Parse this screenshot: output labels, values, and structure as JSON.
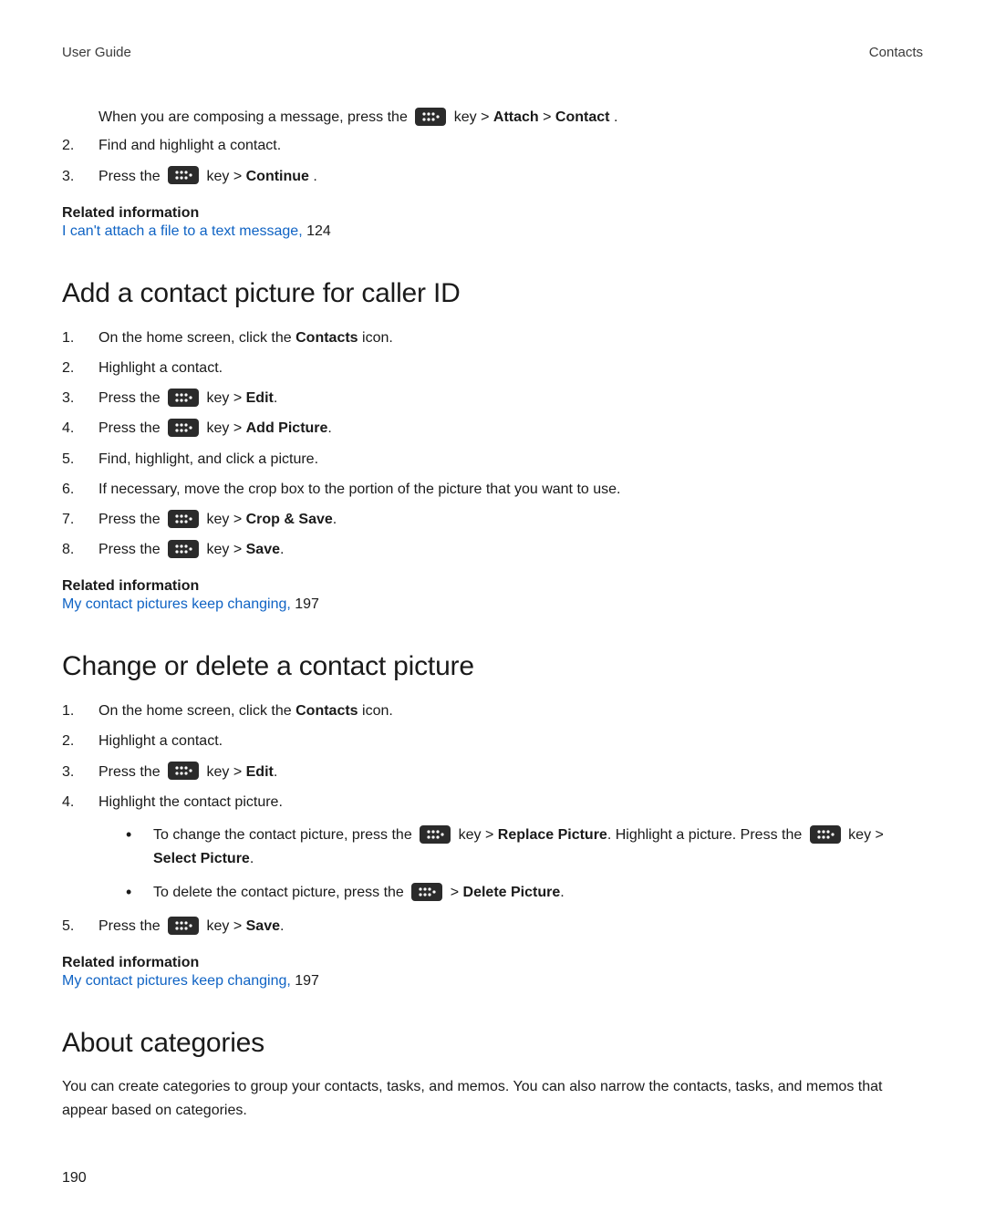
{
  "header": {
    "left": "User Guide",
    "right": "Contacts"
  },
  "page_number": "190",
  "intro_steps": {
    "s1": {
      "indent_text_a": "When you are composing a message, press the ",
      "indent_text_b": " key > ",
      "attach": "Attach",
      "sep": " > ",
      "contact": "Contact",
      "period": "."
    },
    "s2": {
      "num": "2.",
      "text": "Find and highlight a contact."
    },
    "s3": {
      "num": "3.",
      "text_a": "Press the ",
      "text_b": " key > ",
      "bold": "Continue",
      "period": "."
    }
  },
  "related1": {
    "heading": "Related information",
    "link": "I can't attach a file to a text message, ",
    "page": "124"
  },
  "sec_add": {
    "title": "Add a contact picture for caller ID",
    "steps": {
      "s1": {
        "num": "1.",
        "a": "On the home screen, click the ",
        "bold": "Contacts",
        "b": " icon."
      },
      "s2": {
        "num": "2.",
        "a": "Highlight a contact."
      },
      "s3": {
        "num": "3.",
        "a": "Press the ",
        "b": " key > ",
        "bold": "Edit",
        "c": "."
      },
      "s4": {
        "num": "4.",
        "a": "Press the ",
        "b": " key > ",
        "bold": "Add Picture",
        "c": "."
      },
      "s5": {
        "num": "5.",
        "a": "Find, highlight, and click a picture."
      },
      "s6": {
        "num": "6.",
        "a": "If necessary, move the crop box to the portion of the picture that you want to use."
      },
      "s7": {
        "num": "7.",
        "a": "Press the ",
        "b": " key > ",
        "bold": "Crop & Save",
        "c": "."
      },
      "s8": {
        "num": "8.",
        "a": "Press the ",
        "b": " key > ",
        "bold": "Save",
        "c": "."
      }
    },
    "related": {
      "heading": "Related information",
      "link": "My contact pictures keep changing, ",
      "page": "197"
    }
  },
  "sec_change": {
    "title": "Change or delete a contact picture",
    "steps": {
      "s1": {
        "num": "1.",
        "a": "On the home screen, click the ",
        "bold": "Contacts",
        "b": " icon."
      },
      "s2": {
        "num": "2.",
        "a": "Highlight a contact."
      },
      "s3": {
        "num": "3.",
        "a": "Press the ",
        "b": " key > ",
        "bold": "Edit",
        "c": "."
      },
      "s4": {
        "num": "4.",
        "a": "Highlight the contact picture."
      },
      "sub1": {
        "a": "To change the contact picture, press the ",
        "b": " key > ",
        "bold1": "Replace Picture",
        "c": ". Highlight a picture. Press the ",
        "d": " key ",
        "e": "> ",
        "bold2": "Select Picture",
        "f": "."
      },
      "sub2": {
        "a": "To delete the contact picture, press the ",
        "b": "  > ",
        "bold": "Delete Picture",
        "c": "."
      },
      "s5": {
        "num": "5.",
        "a": "Press the ",
        "b": " key > ",
        "bold": "Save",
        "c": "."
      }
    },
    "related": {
      "heading": "Related information",
      "link": "My contact pictures keep changing, ",
      "page": "197"
    }
  },
  "sec_about": {
    "title": "About categories",
    "para": "You can create categories to group your contacts, tasks, and memos. You can also narrow the contacts, tasks, and memos that appear based on categories."
  }
}
